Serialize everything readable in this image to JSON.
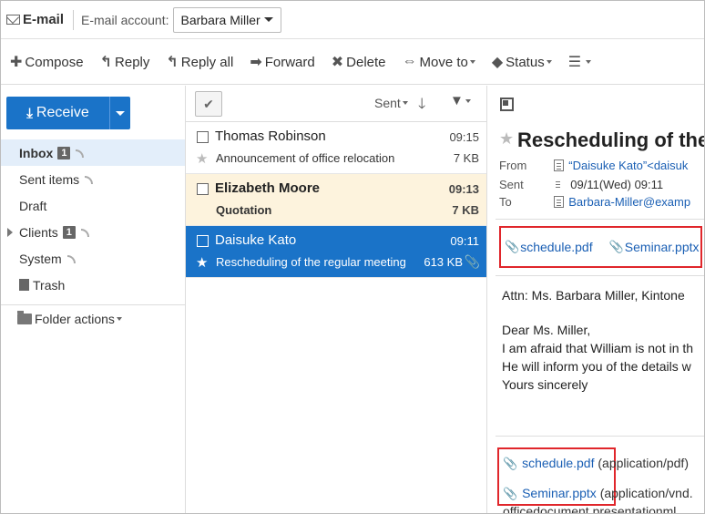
{
  "header": {
    "app_title": "E-mail",
    "account_label": "E-mail account:",
    "account_value": "Barbara Miller"
  },
  "toolbar": {
    "compose": "Compose",
    "reply": "Reply",
    "reply_all": "Reply all",
    "forward": "Forward",
    "delete": "Delete",
    "move_to": "Move to",
    "status": "Status"
  },
  "sidebar": {
    "receive": "Receive",
    "folders": [
      {
        "label": "Inbox",
        "badge": "1"
      },
      {
        "label": "Sent items"
      },
      {
        "label": "Draft"
      },
      {
        "label": "Clients",
        "badge": "1"
      },
      {
        "label": "System"
      },
      {
        "label": "Trash"
      }
    ],
    "folder_actions": "Folder actions"
  },
  "list": {
    "sort_label": "Sent",
    "messages": [
      {
        "sender": "Thomas Robinson",
        "time": "09:15",
        "subject": "Announcement of office relocation",
        "size": "7 KB"
      },
      {
        "sender": "Elizabeth Moore",
        "time": "09:13",
        "subject": "Quotation",
        "size": "7 KB"
      },
      {
        "sender": "Daisuke Kato",
        "time": "09:11",
        "subject": "Rescheduling of the regular meeting",
        "size": "613 KB"
      }
    ]
  },
  "reader": {
    "title": "Rescheduling of the",
    "from_label": "From",
    "from_value": "“Daisuke Kato”<daisuk",
    "sent_label": "Sent",
    "sent_value": "09/11(Wed) 09:11",
    "to_label": "To",
    "to_value": "Barbara-Miller@examp",
    "attachments": [
      "schedule.pdf",
      "Seminar.pptx"
    ],
    "body": {
      "line1": "Attn: Ms. Barbara Miller, Kintone",
      "line2": "Dear Ms. Miller,",
      "line3": "I am afraid that William is not in th",
      "line4": "He will inform you of the details w",
      "line5": "Yours sincerely"
    },
    "attachment_list": [
      {
        "name": "schedule.pdf",
        "type": "(application/pdf)"
      },
      {
        "name": "Seminar.pptx",
        "type": "(application/vnd."
      }
    ],
    "attachment_type_tail": "officedocument.presentationml"
  }
}
